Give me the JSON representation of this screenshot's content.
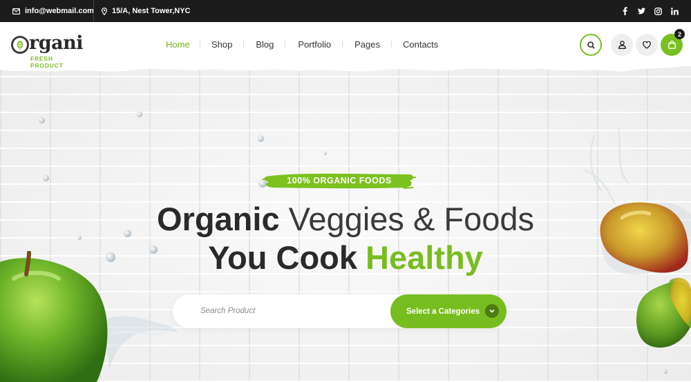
{
  "topbar": {
    "email": "info@webmail.com",
    "address": "15/A, Nest Tower,NYC",
    "social": [
      {
        "icon": "facebook-icon",
        "glyph": "f"
      },
      {
        "icon": "twitter-icon",
        "glyph": "t"
      },
      {
        "icon": "instagram-icon",
        "glyph": "ig"
      },
      {
        "icon": "linkedin-icon",
        "glyph": "in"
      }
    ]
  },
  "logo": {
    "text": "rgani",
    "mark": "O",
    "subtitle": "FRESH PRODUCT"
  },
  "nav": {
    "items": [
      {
        "label": "Home",
        "active": true
      },
      {
        "label": "Shop"
      },
      {
        "label": "Blog"
      },
      {
        "label": "Portfolio"
      },
      {
        "label": "Pages"
      },
      {
        "label": "Contacts"
      }
    ]
  },
  "header_actions": {
    "cart_count": "2"
  },
  "hero": {
    "tagline": "100% ORGANIC FOODS",
    "line1_bold": "Organic",
    "line1_light": " Veggies & Foods",
    "line2_dark": "You Cook",
    "line2_green": "Healthy",
    "search_placeholder": "Search Product",
    "category_button": "Select a Categories"
  },
  "colors": {
    "accent": "#78bd1f",
    "topbar": "#1c1c1c",
    "text_dark": "#2a2a2a"
  }
}
